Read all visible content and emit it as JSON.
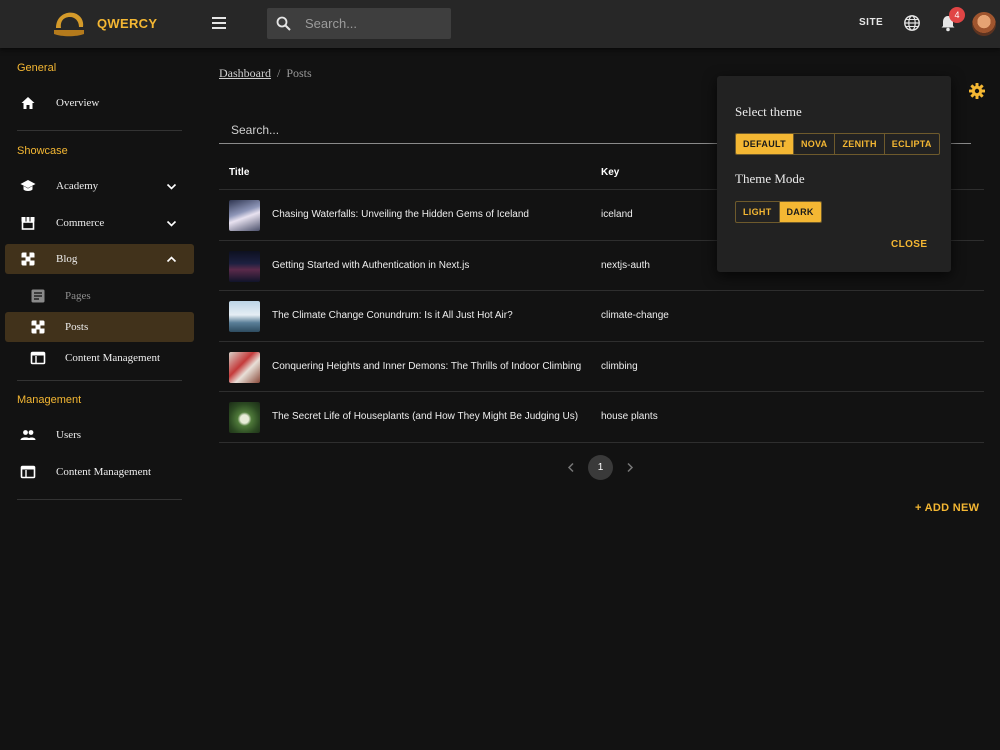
{
  "app": {
    "brand": "QWERCY",
    "accent": "#f4b733"
  },
  "topbar": {
    "search_placeholder": "Search...",
    "site_label": "SITE",
    "notification_count": "4",
    "icons": [
      "menu-icon",
      "search-icon",
      "globe-icon",
      "bell-icon"
    ]
  },
  "sidebar": {
    "sections": {
      "general": "General",
      "showcase": "Showcase",
      "management": "Management"
    },
    "items": {
      "overview": "Overview",
      "academy": "Academy",
      "commerce": "Commerce",
      "blog": "Blog",
      "pages": "Pages",
      "posts": "Posts",
      "blog_content_management": "Content Management",
      "users": "Users",
      "content_management": "Content Management"
    }
  },
  "breadcrumb": {
    "home": "Dashboard",
    "separator": "/",
    "current": "Posts"
  },
  "table": {
    "search_placeholder": "Search...",
    "headers": {
      "title": "Title",
      "key": "Key"
    },
    "rows": [
      {
        "title": "Chasing Waterfalls: Unveiling the Hidden Gems of Iceland",
        "key": "iceland"
      },
      {
        "title": "Getting Started with Authentication in Next.js",
        "key": "nextjs-auth"
      },
      {
        "title": "The Climate Change Conundrum: Is it All Just Hot Air?",
        "key": "climate-change"
      },
      {
        "title": "Conquering Heights and Inner Demons: The Thrills of Indoor Climbing",
        "key": "climbing"
      },
      {
        "title": "The Secret Life of Houseplants (and How They Might Be Judging Us)",
        "key": "house plants"
      }
    ]
  },
  "pagination": {
    "current_page": "1"
  },
  "actions": {
    "add_new": "+ ADD NEW"
  },
  "theme_popover": {
    "theme_heading": "Select theme",
    "themes": [
      "DEFAULT",
      "NOVA",
      "ZENITH",
      "ECLIPTA"
    ],
    "selected_theme": "DEFAULT",
    "mode_heading": "Theme Mode",
    "modes": [
      "LIGHT",
      "DARK"
    ],
    "selected_mode": "DARK",
    "close_label": "CLOSE"
  }
}
